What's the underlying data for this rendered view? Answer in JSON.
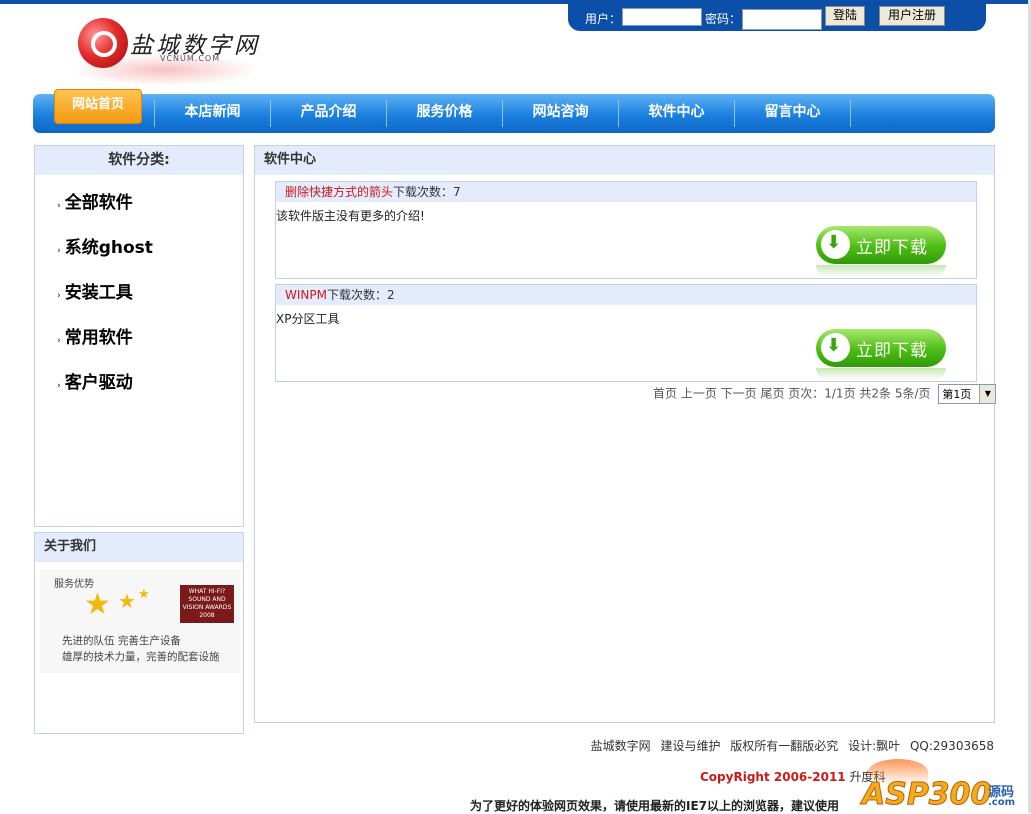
{
  "logo": {
    "title": "盐城数字网",
    "subtitle": "VCNUM.COM"
  },
  "login": {
    "user_label": "用户：",
    "password_label": "密码：",
    "login_button": "登陆",
    "register_button": "用户注册"
  },
  "nav": {
    "home": "网站首页",
    "items": [
      "本店新闻",
      "产品介绍",
      "服务价格",
      "网站咨询",
      "软件中心",
      "留言中心"
    ]
  },
  "sidebar": {
    "category_title": "软件分类:",
    "categories": [
      "全部软件",
      "系统ghost",
      "安装工具",
      "常用软件",
      "客户驱动"
    ],
    "about_title": "关于我们",
    "about_image": {
      "heading": "服务优势",
      "badge": "WHAT HI-FI? SOUND AND VISION AWARDS 2008",
      "line1": "先进的队伍  完善生产设备",
      "line2": "雄厚的技术力量，完善的配套设施"
    }
  },
  "main": {
    "title": "软件中心",
    "download_count_label": "下载次数：",
    "download_button": "立即下载",
    "software": [
      {
        "name": "删除快捷方式的箭头",
        "count": "7",
        "description": "该软件版主没有更多的介绍!"
      },
      {
        "name": "WINPM",
        "count": "2",
        "description": "XP分区工具"
      }
    ],
    "pager": {
      "text": "首页 上一页 下一页 尾页 页次：1/1页 共2条 5条/页",
      "select_value": "第1页"
    }
  },
  "footer": {
    "links": "盐城数字网  建设与维护  版权所有一翻版必究  设计:飘叶  QQ:29303658",
    "copyright": "CopyRight 2006-2011",
    "copyright_tail": "升度科",
    "notice": "为了更好的体验网页效果，请使用最新的IE7以上的浏览器，建议使用"
  },
  "watermark": {
    "text": "ASP300",
    "sub": "源码",
    "domain": ".com"
  },
  "colors": {
    "nav_blue": "#1a7fde",
    "home_orange": "#f49a12",
    "head_bg": "#e4ebfb",
    "link_red": "#cc1a1a",
    "download_green": "#4dbd14"
  }
}
